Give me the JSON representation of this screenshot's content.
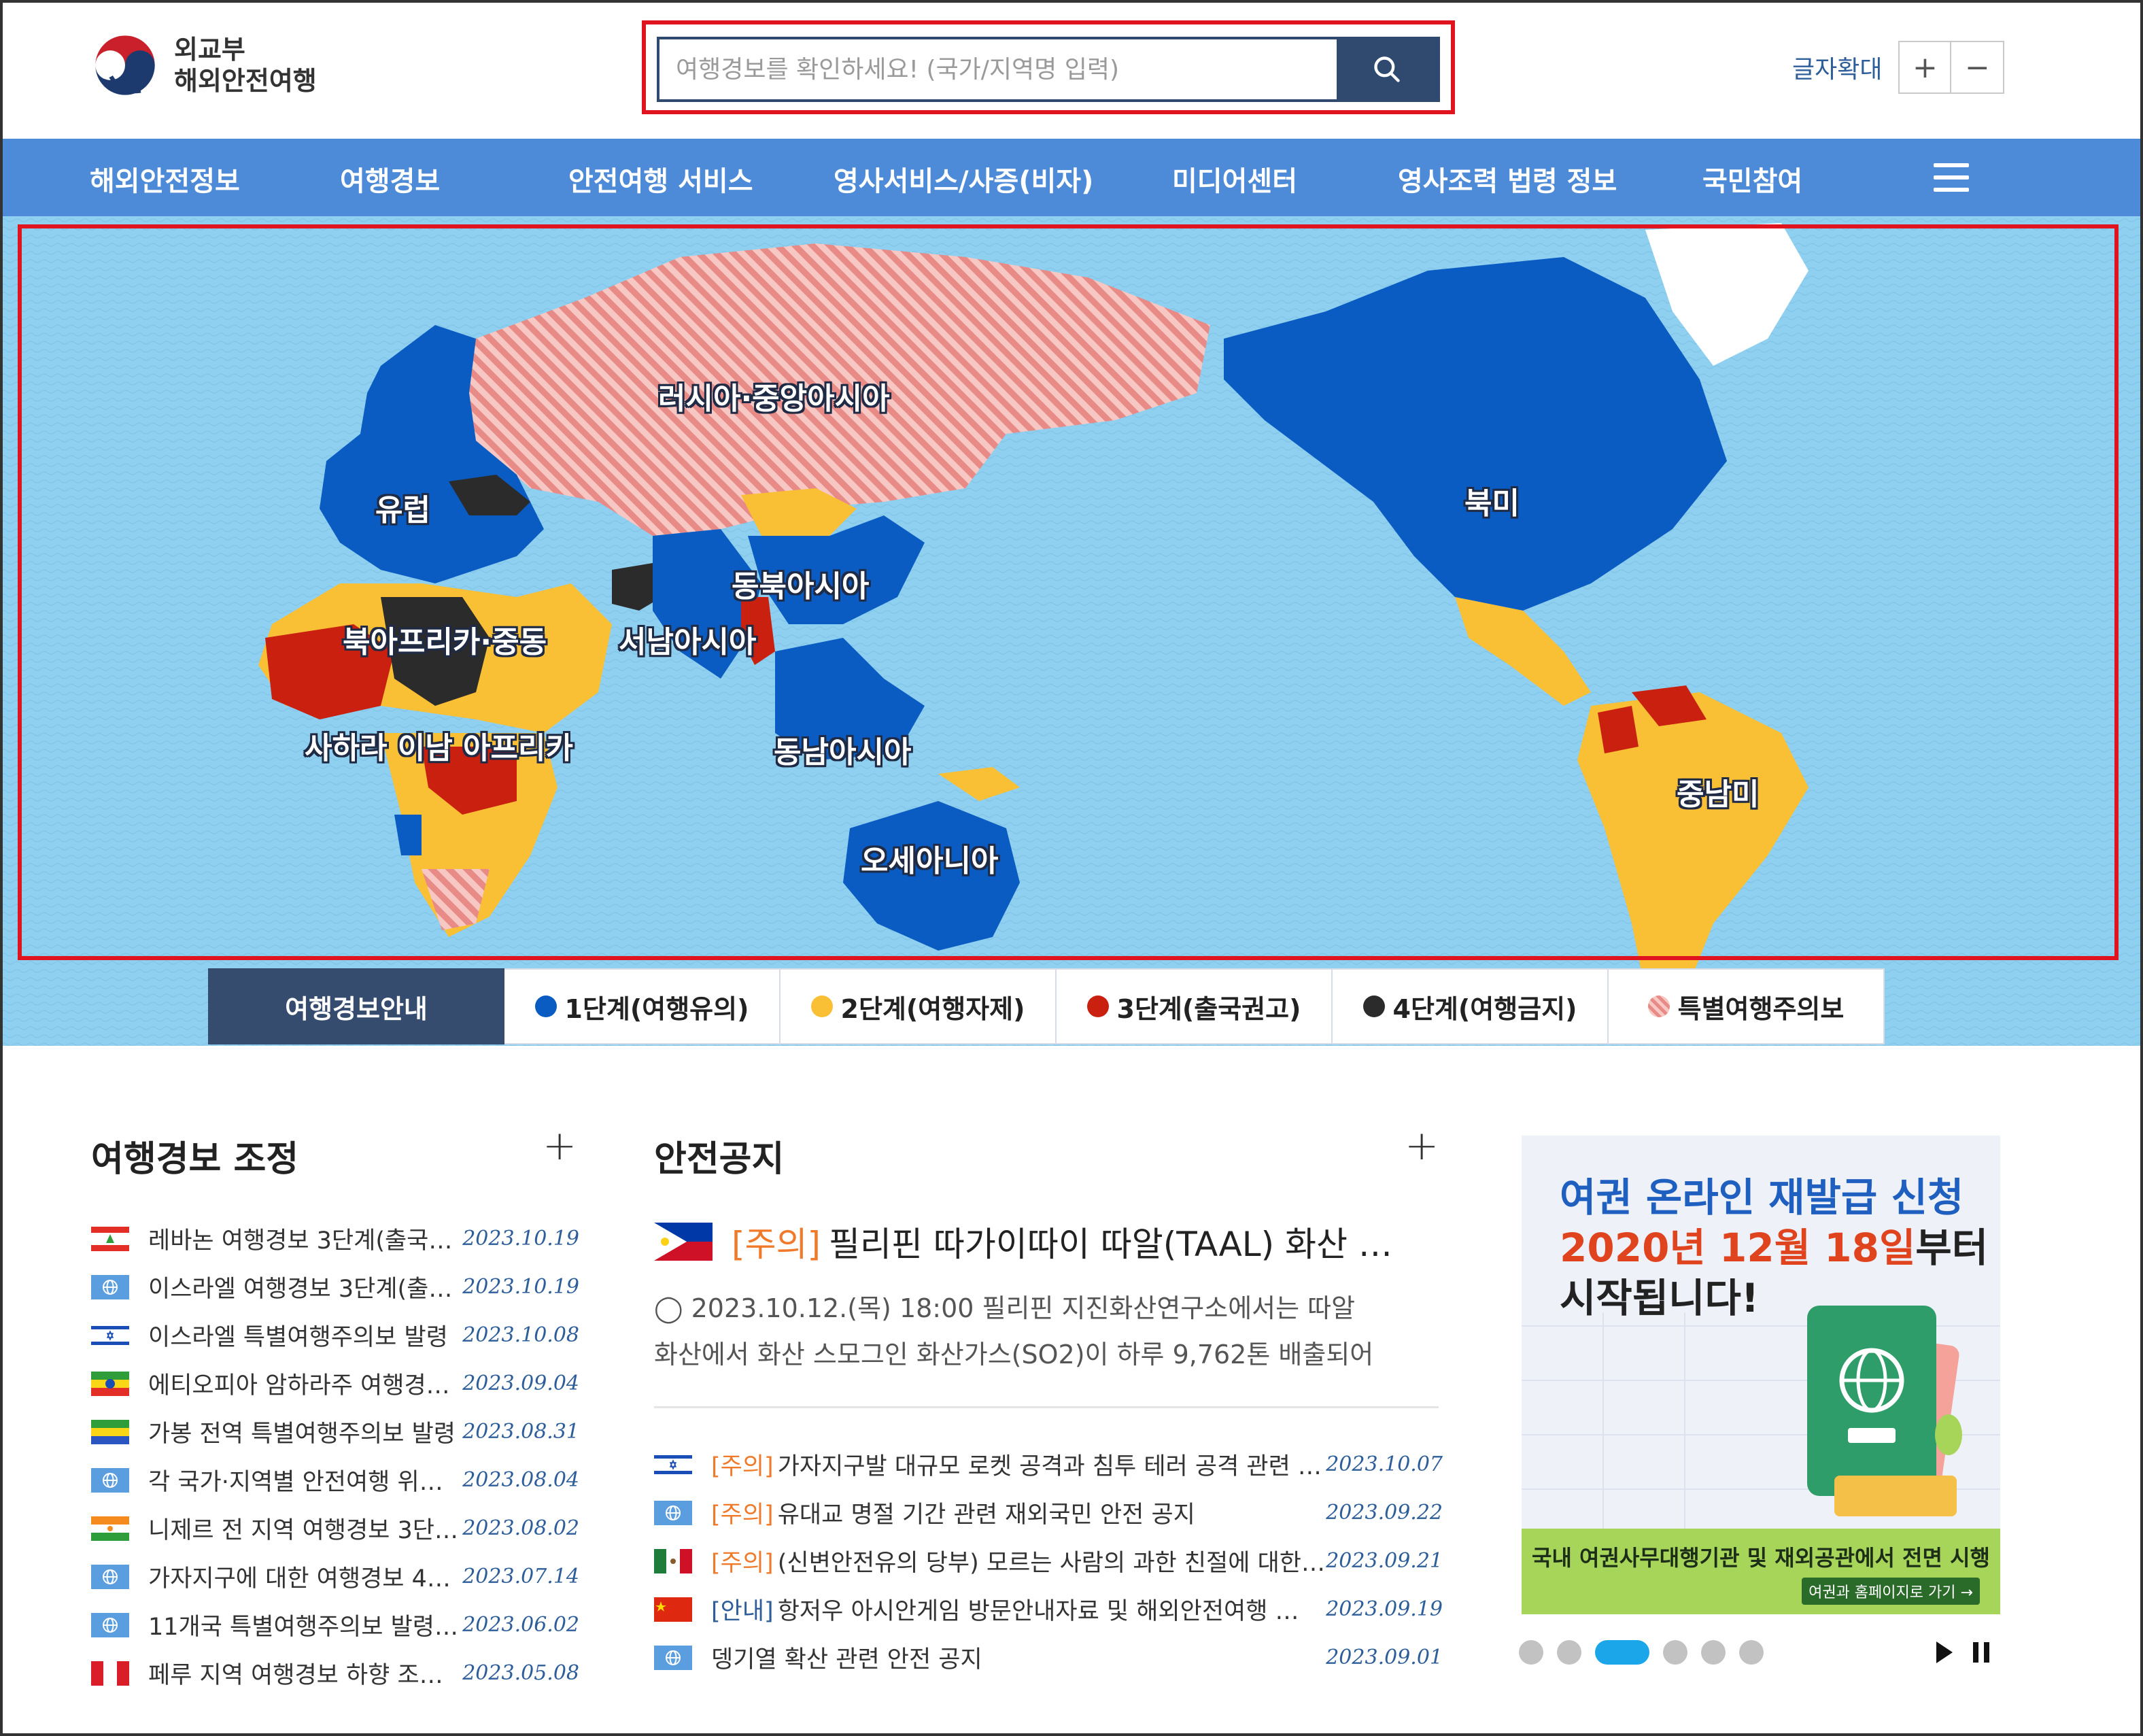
{
  "header": {
    "logo_line1": "외교부",
    "logo_line2": "해외안전여행",
    "search_placeholder": "여행경보를 확인하세요! (국가/지역명 입력)",
    "search_icon": "search-icon",
    "fontsize_label": "글자확대",
    "fontsize_plus": "+",
    "fontsize_minus": "−"
  },
  "nav": {
    "items": [
      "해외안전정보",
      "여행경보",
      "안전여행 서비스",
      "영사서비스/사증(비자)",
      "미디어센터",
      "영사조력 법령 정보",
      "국민참여"
    ],
    "menu_icon": "hamburger-icon"
  },
  "map": {
    "regions": [
      "러시아·중앙아시아",
      "유럽",
      "북미",
      "동북아시아",
      "북아프리카·중동",
      "서남아시아",
      "사하라 이남 아프리카",
      "동남아시아",
      "중남미",
      "오세아니아"
    ],
    "colors": {
      "level1": "#0a5cc2",
      "level2": "#f9bf35",
      "level3": "#c9200f",
      "level4": "#2b2b2b",
      "special": "#f2a7a7",
      "sea": "#8fd0f0"
    }
  },
  "legend": {
    "title": "여행경보안내",
    "items": [
      {
        "label": "1단계(여행유의)",
        "color": "#0a5cc2"
      },
      {
        "label": "2단계(여행자제)",
        "color": "#f9bf35"
      },
      {
        "label": "3단계(출국권고)",
        "color": "#c9200f"
      },
      {
        "label": "4단계(여행금지)",
        "color": "#2b2b2b"
      },
      {
        "label": "특별여행주의보",
        "color": "#f2a7a7"
      }
    ]
  },
  "adjust": {
    "title": "여행경보 조정",
    "more": "+",
    "items": [
      {
        "text": "레바논 여행경보 3단계(출국…",
        "date": "2023.10.19",
        "flag": "lebanon"
      },
      {
        "text": "이스라엘 여행경보 3단계(출…",
        "date": "2023.10.19",
        "flag": "globe"
      },
      {
        "text": "이스라엘 특별여행주의보 발령",
        "date": "2023.10.08",
        "flag": "israel"
      },
      {
        "text": "에티오피아 암하라주 여행경…",
        "date": "2023.09.04",
        "flag": "ethiopia"
      },
      {
        "text": "가봉 전역 특별여행주의보 발령",
        "date": "2023.08.31",
        "flag": "gabon"
      },
      {
        "text": "각 국가·지역별 안전여행 위…",
        "date": "2023.08.04",
        "flag": "globe"
      },
      {
        "text": "니제르 전 지역 여행경보 3단…",
        "date": "2023.08.02",
        "flag": "niger"
      },
      {
        "text": "가자지구에 대한 여행경보 4…",
        "date": "2023.07.14",
        "flag": "globe"
      },
      {
        "text": "11개국 특별여행주의보 발령 …",
        "date": "2023.06.02",
        "flag": "globe"
      },
      {
        "text": "페루 지역 여행경보 하향 조정…",
        "date": "2023.05.08",
        "flag": "peru"
      }
    ]
  },
  "notice": {
    "title": "안전공지",
    "more": "+",
    "headline": {
      "tag": "[주의]",
      "title": "필리핀 따가이따이 따알(TAAL) 화산 …",
      "body1": "◯ 2023.10.12.(목) 18:00 필리핀 지진화산연구소에서는 따알",
      "body2": "화산에서 화산 스모그인 화산가스(SO2)이 하루 9,762톤 배출되어"
    },
    "items": [
      {
        "tag": "[주의]",
        "text": "가자지구발 대규모 로켓 공격과 침투 테러 공격 관련 …",
        "date": "2023.10.07",
        "flag": "israel",
        "kind": "warn"
      },
      {
        "tag": "[주의]",
        "text": "유대교 명절 기간 관련 재외국민 안전 공지",
        "date": "2023.09.22",
        "flag": "globe",
        "kind": "warn"
      },
      {
        "tag": "[주의]",
        "text": "(신변안전유의 당부) 모르는 사람의 과한 친절에 대한…",
        "date": "2023.09.21",
        "flag": "mexico",
        "kind": "warn"
      },
      {
        "tag": "[안내]",
        "text": "항저우 아시안게임 방문안내자료 및 해외안전여행 …",
        "date": "2023.09.19",
        "flag": "china",
        "kind": "info"
      },
      {
        "tag": "",
        "text": "뎅기열 확산 관련 안전 공지",
        "date": "2023.09.01",
        "flag": "globe",
        "kind": "none"
      }
    ]
  },
  "banner": {
    "line1": "여권 온라인 재발급 신청",
    "line2a": "2020년 12월 18일",
    "line2b": "부터",
    "line3": "시작됩니다!",
    "footer": "국내 여권사무대행기관 및 재외공관에서 전면 시행",
    "button": "여권과 홈페이지로 가기 →"
  },
  "carousel": {
    "slides": 6,
    "active": 3,
    "play_icon": "play-icon",
    "pause_icon": "pause-icon"
  }
}
